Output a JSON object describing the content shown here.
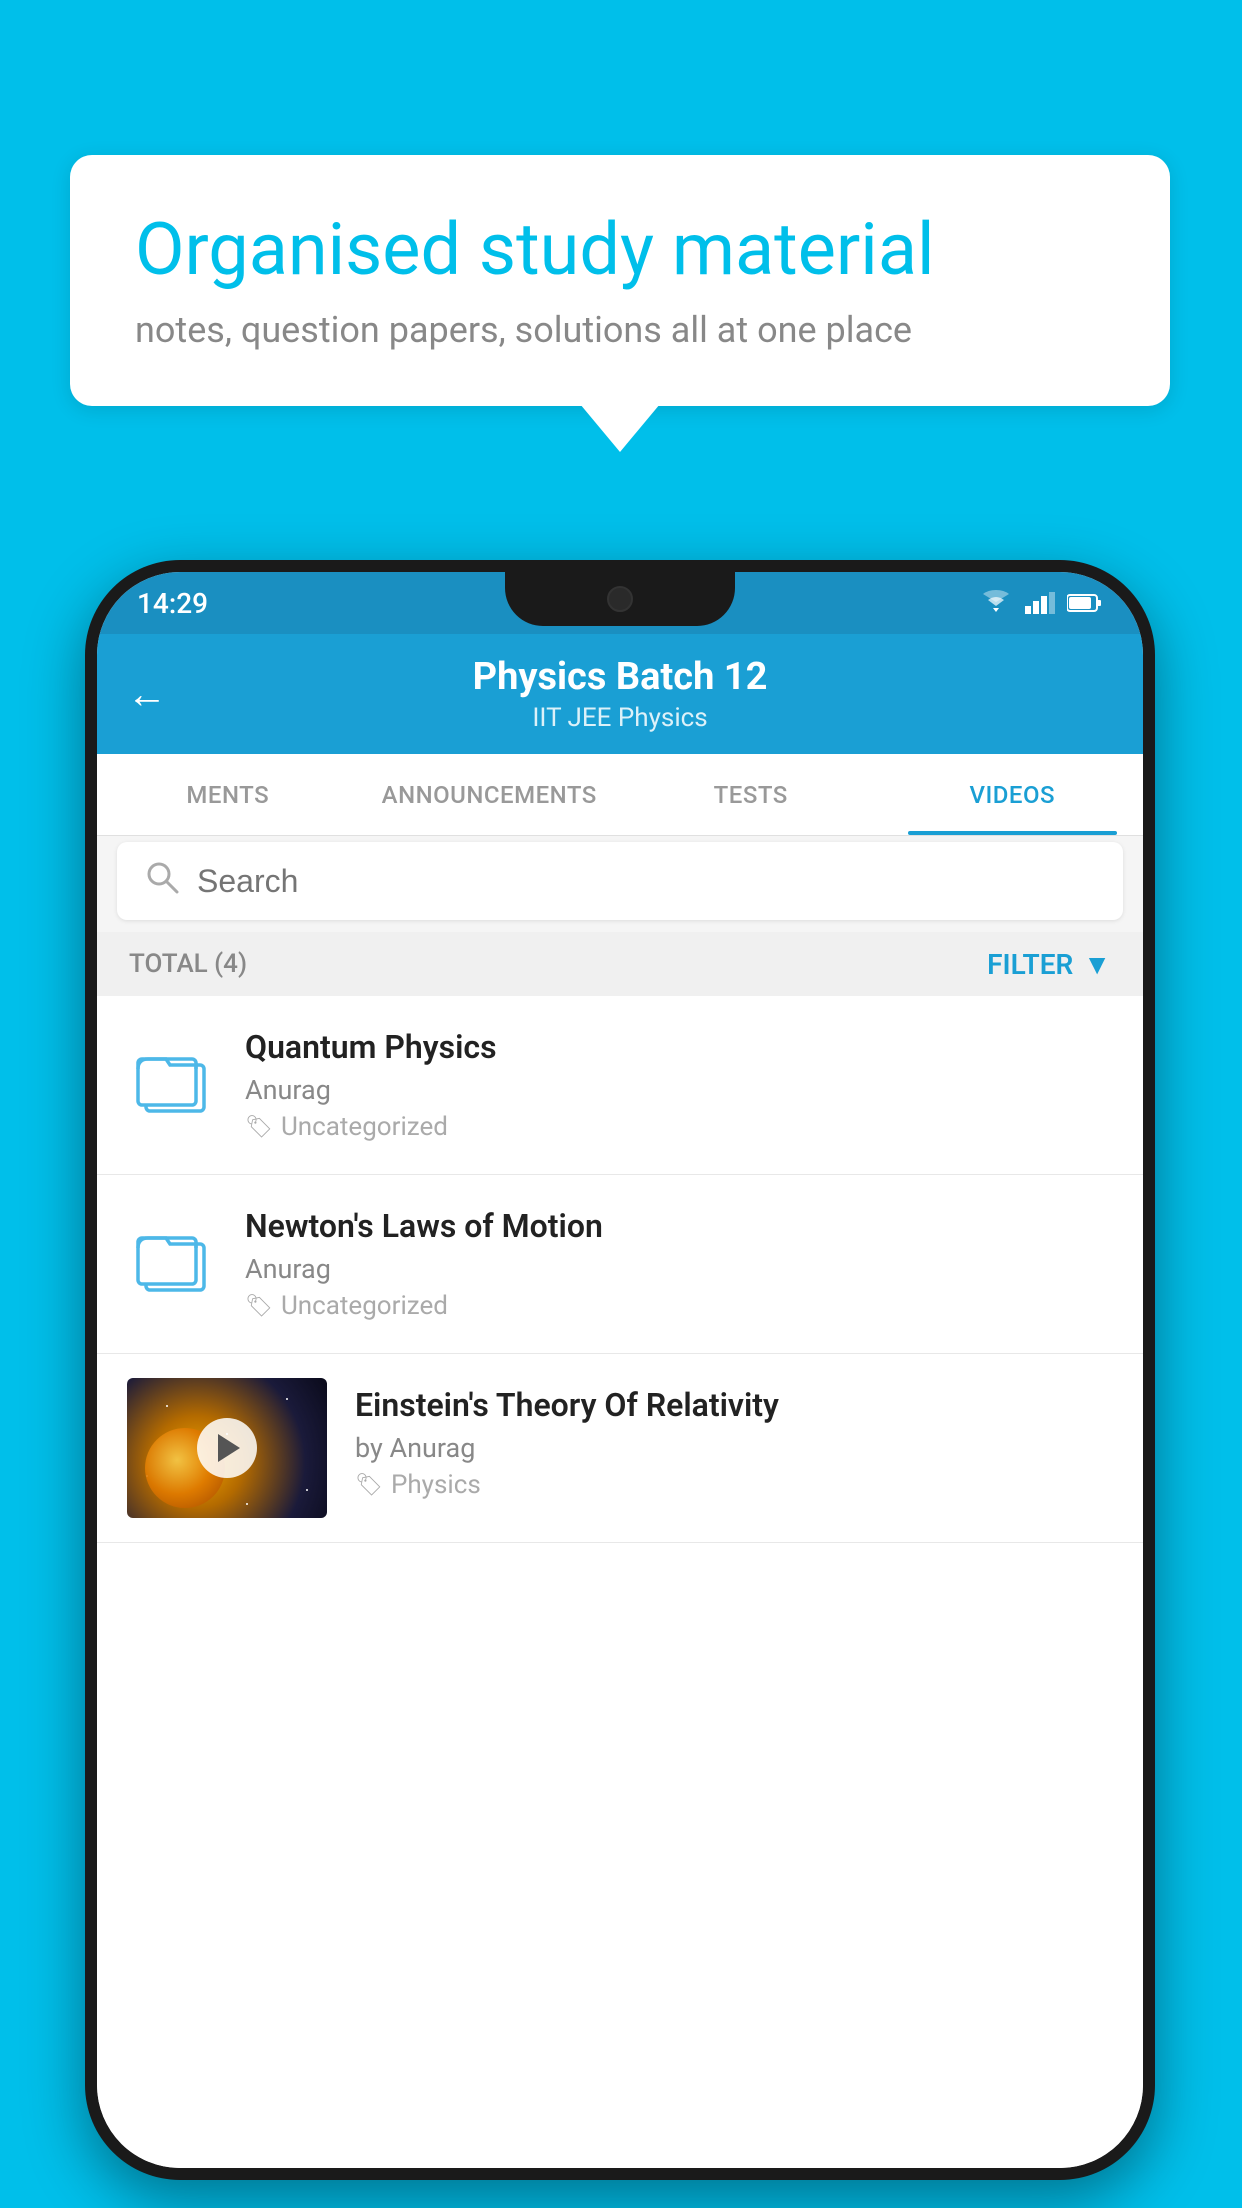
{
  "background_color": "#00BFEA",
  "speech_bubble": {
    "title": "Organised study material",
    "subtitle": "notes, question papers, solutions all at one place"
  },
  "status_bar": {
    "time": "14:29"
  },
  "header": {
    "title": "Physics Batch 12",
    "subtitle": "IIT JEE   Physics",
    "back_label": "←"
  },
  "tabs": [
    {
      "label": "MENTS",
      "active": false
    },
    {
      "label": "ANNOUNCEMENTS",
      "active": false
    },
    {
      "label": "TESTS",
      "active": false
    },
    {
      "label": "VIDEOS",
      "active": true
    }
  ],
  "search": {
    "placeholder": "Search"
  },
  "filter": {
    "total_label": "TOTAL (4)",
    "button_label": "FILTER"
  },
  "list_items": [
    {
      "title": "Quantum Physics",
      "author": "Anurag",
      "tag": "Uncategorized",
      "type": "folder"
    },
    {
      "title": "Newton's Laws of Motion",
      "author": "Anurag",
      "tag": "Uncategorized",
      "type": "folder"
    },
    {
      "title": "Einstein's Theory Of Relativity",
      "author": "by Anurag",
      "tag": "Physics",
      "type": "video"
    }
  ]
}
